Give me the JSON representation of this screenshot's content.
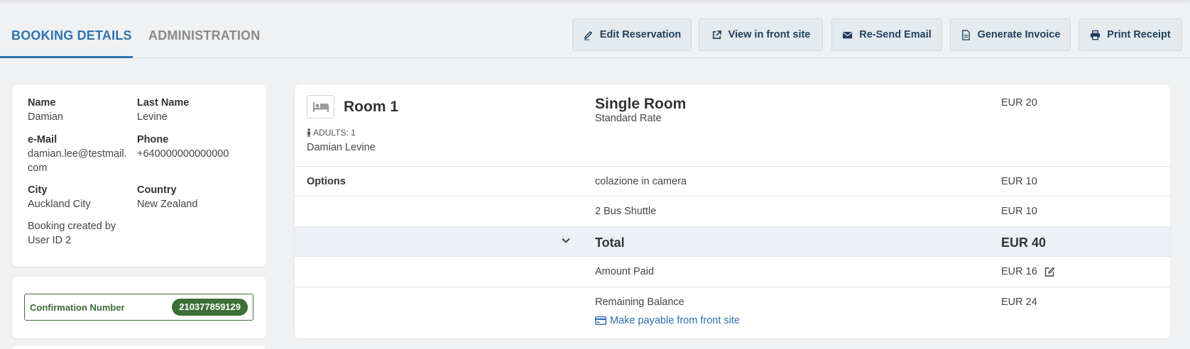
{
  "tabs": [
    {
      "label": "BOOKING DETAILS",
      "active": true
    },
    {
      "label": "ADMINISTRATION",
      "active": false
    }
  ],
  "toolbar": [
    {
      "label": "Edit Reservation",
      "icon": "pencil-icon"
    },
    {
      "label": "View in front site",
      "icon": "external-link-icon"
    },
    {
      "label": "Re-Send Email",
      "icon": "envelope-icon"
    },
    {
      "label": "Generate Invoice",
      "icon": "document-icon"
    },
    {
      "label": "Print Receipt",
      "icon": "printer-icon"
    }
  ],
  "guest": {
    "name_label": "Name",
    "name": "Damian",
    "lastname_label": "Last Name",
    "lastname": "Levine",
    "email_label": "e-Mail",
    "email_line1": "damian.lee@testmail.",
    "email_line2": "com",
    "phone_label": "Phone",
    "phone": "+640000000000000",
    "city_label": "City",
    "city": "Auckland City",
    "country_label": "Country",
    "country": "New Zealand",
    "created_line1": "Booking created by",
    "created_line2": "User ID 2"
  },
  "confirmation": {
    "label": "Confirmation Number",
    "number": "210377859129"
  },
  "room": {
    "title": "Room 1",
    "adults": "ADULTS: 1",
    "guest_name": "Damian Levine",
    "type": "Single Room",
    "rate": "Standard Rate",
    "price": "EUR 20"
  },
  "options": {
    "label": "Options",
    "items": [
      {
        "name": "colazione in camera",
        "price": "EUR 10"
      },
      {
        "name": "2 Bus Shuttle",
        "price": "EUR 10"
      }
    ]
  },
  "totals": {
    "total_label": "Total",
    "total": "EUR 40",
    "paid_label": "Amount Paid",
    "paid": "EUR 16",
    "balance_label": "Remaining Balance",
    "balance": "EUR 24",
    "payable_link": "Make payable from front site"
  },
  "colors": {
    "accent": "#2e74b1",
    "confirm_green": "#3c6f37",
    "link": "#2e6db0"
  }
}
